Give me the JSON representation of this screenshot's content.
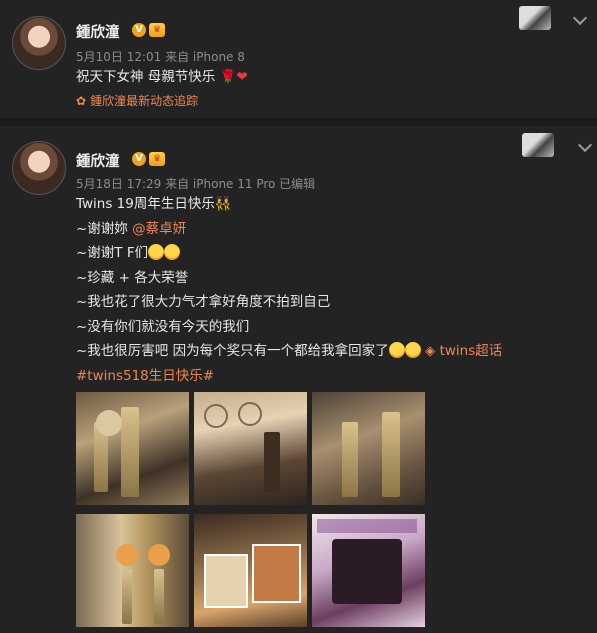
{
  "post1": {
    "username": "鍾欣潼",
    "v_badge": "V",
    "meta": "5月10日 12:01 来自 iPhone 8",
    "text": "祝天下女神 母親节快乐",
    "source_link": "鍾欣潼最新动态追踪"
  },
  "post2": {
    "username": "鍾欣潼",
    "v_badge": "V",
    "meta": "5月18日 17:29 来自 iPhone 11 Pro  已编辑",
    "lines": [
      "Twins 19周年生日快乐👯‍♀",
      "~谢谢妳 ",
      "~谢谢T F们",
      "~珍藏 + 各大荣誉",
      "~我也花了很大力气才拿好角度不拍到自己",
      "~没有你们就没有今天的我们",
      "~我也很厉害吧 因为每个奖只有一个都给我拿回家了"
    ],
    "mention": "@蔡卓妍",
    "topic_link": "twins超话",
    "hashtag": "#twins518生日快乐#"
  },
  "colors": {
    "accent": "#f0864f",
    "background": "#232324",
    "vip": "#f0a21a"
  }
}
